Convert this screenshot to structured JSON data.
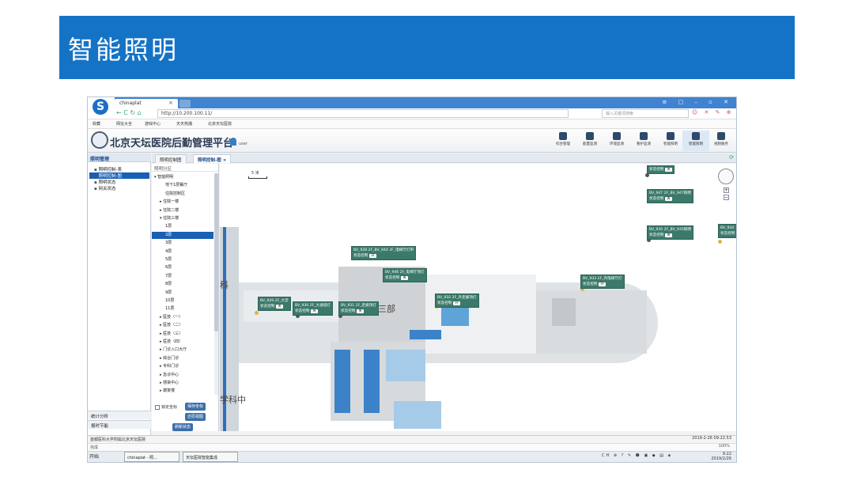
{
  "slide": {
    "title": "智能照明"
  },
  "browser": {
    "tab_title": "chinaplat",
    "tab_close": "×",
    "url": "http://10.200.100.11/",
    "search_placeholder": "输入关键词搜索",
    "win_controls": "≡ ▢ – ▫ ✕",
    "nav": "← C ↻ ⌂",
    "addr_tools": "☺ ✕ ✎ ⊕",
    "bookmarks": [
      "收藏",
      "网址大全",
      "游戏中心",
      "天天热播",
      "北京天坛医院"
    ]
  },
  "app": {
    "title": "北京天坛医院后勤管理平台",
    "user": "user",
    "topnav": [
      {
        "label": "综合管理"
      },
      {
        "label": "能量监测"
      },
      {
        "label": "环境监测"
      },
      {
        "label": "看护监测"
      },
      {
        "label": "智能照明"
      },
      {
        "label": "智能照明"
      },
      {
        "label": "视频服务"
      }
    ],
    "header_controls": [
      "✖",
      "≡",
      "⇥"
    ]
  },
  "sidebar": {
    "header": "照明管理",
    "items": [
      {
        "label": "照明控制-表"
      },
      {
        "label": "照明控制-图"
      },
      {
        "label": "照明状态"
      },
      {
        "label": "网关状态"
      }
    ],
    "bottom": [
      {
        "label": "统计分析"
      },
      {
        "label": "报时节能"
      }
    ]
  },
  "tabs": [
    {
      "label": "照明控制图"
    },
    {
      "label": "照明控制-图 ×"
    }
  ],
  "tree": {
    "header": "照明分区",
    "nodes": [
      {
        "label": "▾ 智能照明",
        "indent": 0
      },
      {
        "label": "地下1层餐厅",
        "indent": 2
      },
      {
        "label": "住院控制区",
        "indent": 2
      },
      {
        "label": "▸ 住院一楼",
        "indent": 1
      },
      {
        "label": "▸ 住院二楼",
        "indent": 1
      },
      {
        "label": "▾ 住院三楼",
        "indent": 1
      },
      {
        "label": "1层",
        "indent": 2
      },
      {
        "label": "2层",
        "indent": 2,
        "selected": true
      },
      {
        "label": "3层",
        "indent": 2
      },
      {
        "label": "4层",
        "indent": 2
      },
      {
        "label": "5层",
        "indent": 2
      },
      {
        "label": "6层",
        "indent": 2
      },
      {
        "label": "7层",
        "indent": 2
      },
      {
        "label": "8层",
        "indent": 2
      },
      {
        "label": "9层",
        "indent": 2
      },
      {
        "label": "10层",
        "indent": 2
      },
      {
        "label": "11层",
        "indent": 2
      },
      {
        "label": "▸ 医技（一）",
        "indent": 1
      },
      {
        "label": "▸ 医技（二）",
        "indent": 1
      },
      {
        "label": "▸ 医技（三）",
        "indent": 1
      },
      {
        "label": "▸ 医技（四）",
        "indent": 1
      },
      {
        "label": "▸ 门诊入口大厅",
        "indent": 1
      },
      {
        "label": "▸ 综合门诊",
        "indent": 1
      },
      {
        "label": "▸ 专科门诊",
        "indent": 1
      },
      {
        "label": "▸ 急诊中心",
        "indent": 1
      },
      {
        "label": "▸ 感染中心",
        "indent": 1
      },
      {
        "label": "▸ 康复楼",
        "indent": 1
      }
    ],
    "lock_label": "锁定坐标",
    "buttons": {
      "save": "保存坐标",
      "restore": "还原视图",
      "refresh": "刷新状态"
    }
  },
  "map": {
    "scale": "5 米",
    "labels": [
      "科",
      "住院三部",
      "学科中"
    ],
    "cards": [
      {
        "title": "",
        "status": "状态控制",
        "switch": "关"
      },
      {
        "title": "BV_947 2F_BV_947照明",
        "status": "状态控制",
        "switch": "关"
      },
      {
        "title": "BV_935 2F_BV_935照明",
        "status": "状态控制",
        "switch": "关"
      },
      {
        "title": "BV_934",
        "status": "状态控制",
        "switch": "关"
      },
      {
        "title": "BV_928 2F_BV_944 2F_电梯厅灯带",
        "status": "状态控制",
        "switch": "开"
      },
      {
        "title": "BV_946 2F_电梯厅顶灯",
        "status": "状态控制",
        "switch": "关"
      },
      {
        "title": "BV_933 2F_内电梯厅灯",
        "status": "状态控制",
        "switch": "开"
      },
      {
        "title": "BV_929 2F_大堂",
        "status": "状态控制",
        "switch": "关"
      },
      {
        "title": "BV_930 2F_大通道灯",
        "status": "状态控制",
        "switch": "关"
      },
      {
        "title": "BV_931 2F_走廊顶灯",
        "status": "状态控制",
        "switch": "关"
      },
      {
        "title": "BV_932 2F_外走廊顶灯",
        "status": "状态控制",
        "switch": "开"
      }
    ]
  },
  "status": {
    "left": "首都医科大学附属北京天坛医院",
    "right": "2019-2-26 09:22:53"
  },
  "ie_status": {
    "left": "完成",
    "zoom": "100%"
  },
  "taskbar": {
    "start": "开始",
    "tasks": [
      "chinaplat - 照...",
      "天坛医院智能集成"
    ],
    "tray": "CH ⊕ ? ✎ ☻ ▣ ◆ ▤ ◈",
    "time": "9:22",
    "date": "2019/2/26"
  },
  "colors": {
    "banner": "#1573c6",
    "accent": "#1a5fb4",
    "card": "#3b7a6a"
  }
}
